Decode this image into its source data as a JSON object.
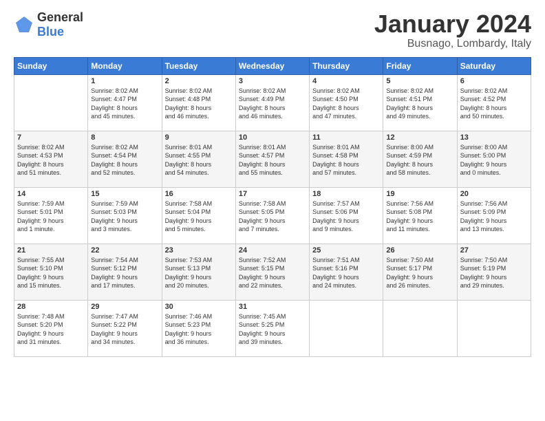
{
  "header": {
    "logo": {
      "general": "General",
      "blue": "Blue"
    },
    "title": "January 2024",
    "location": "Busnago, Lombardy, Italy"
  },
  "calendar": {
    "days_of_week": [
      "Sunday",
      "Monday",
      "Tuesday",
      "Wednesday",
      "Thursday",
      "Friday",
      "Saturday"
    ],
    "weeks": [
      [
        {
          "day": "",
          "info": ""
        },
        {
          "day": "1",
          "info": "Sunrise: 8:02 AM\nSunset: 4:47 PM\nDaylight: 8 hours\nand 45 minutes."
        },
        {
          "day": "2",
          "info": "Sunrise: 8:02 AM\nSunset: 4:48 PM\nDaylight: 8 hours\nand 46 minutes."
        },
        {
          "day": "3",
          "info": "Sunrise: 8:02 AM\nSunset: 4:49 PM\nDaylight: 8 hours\nand 46 minutes."
        },
        {
          "day": "4",
          "info": "Sunrise: 8:02 AM\nSunset: 4:50 PM\nDaylight: 8 hours\nand 47 minutes."
        },
        {
          "day": "5",
          "info": "Sunrise: 8:02 AM\nSunset: 4:51 PM\nDaylight: 8 hours\nand 49 minutes."
        },
        {
          "day": "6",
          "info": "Sunrise: 8:02 AM\nSunset: 4:52 PM\nDaylight: 8 hours\nand 50 minutes."
        }
      ],
      [
        {
          "day": "7",
          "info": "Sunrise: 8:02 AM\nSunset: 4:53 PM\nDaylight: 8 hours\nand 51 minutes."
        },
        {
          "day": "8",
          "info": "Sunrise: 8:02 AM\nSunset: 4:54 PM\nDaylight: 8 hours\nand 52 minutes."
        },
        {
          "day": "9",
          "info": "Sunrise: 8:01 AM\nSunset: 4:55 PM\nDaylight: 8 hours\nand 54 minutes."
        },
        {
          "day": "10",
          "info": "Sunrise: 8:01 AM\nSunset: 4:57 PM\nDaylight: 8 hours\nand 55 minutes."
        },
        {
          "day": "11",
          "info": "Sunrise: 8:01 AM\nSunset: 4:58 PM\nDaylight: 8 hours\nand 57 minutes."
        },
        {
          "day": "12",
          "info": "Sunrise: 8:00 AM\nSunset: 4:59 PM\nDaylight: 8 hours\nand 58 minutes."
        },
        {
          "day": "13",
          "info": "Sunrise: 8:00 AM\nSunset: 5:00 PM\nDaylight: 9 hours\nand 0 minutes."
        }
      ],
      [
        {
          "day": "14",
          "info": "Sunrise: 7:59 AM\nSunset: 5:01 PM\nDaylight: 9 hours\nand 1 minute."
        },
        {
          "day": "15",
          "info": "Sunrise: 7:59 AM\nSunset: 5:03 PM\nDaylight: 9 hours\nand 3 minutes."
        },
        {
          "day": "16",
          "info": "Sunrise: 7:58 AM\nSunset: 5:04 PM\nDaylight: 9 hours\nand 5 minutes."
        },
        {
          "day": "17",
          "info": "Sunrise: 7:58 AM\nSunset: 5:05 PM\nDaylight: 9 hours\nand 7 minutes."
        },
        {
          "day": "18",
          "info": "Sunrise: 7:57 AM\nSunset: 5:06 PM\nDaylight: 9 hours\nand 9 minutes."
        },
        {
          "day": "19",
          "info": "Sunrise: 7:56 AM\nSunset: 5:08 PM\nDaylight: 9 hours\nand 11 minutes."
        },
        {
          "day": "20",
          "info": "Sunrise: 7:56 AM\nSunset: 5:09 PM\nDaylight: 9 hours\nand 13 minutes."
        }
      ],
      [
        {
          "day": "21",
          "info": "Sunrise: 7:55 AM\nSunset: 5:10 PM\nDaylight: 9 hours\nand 15 minutes."
        },
        {
          "day": "22",
          "info": "Sunrise: 7:54 AM\nSunset: 5:12 PM\nDaylight: 9 hours\nand 17 minutes."
        },
        {
          "day": "23",
          "info": "Sunrise: 7:53 AM\nSunset: 5:13 PM\nDaylight: 9 hours\nand 20 minutes."
        },
        {
          "day": "24",
          "info": "Sunrise: 7:52 AM\nSunset: 5:15 PM\nDaylight: 9 hours\nand 22 minutes."
        },
        {
          "day": "25",
          "info": "Sunrise: 7:51 AM\nSunset: 5:16 PM\nDaylight: 9 hours\nand 24 minutes."
        },
        {
          "day": "26",
          "info": "Sunrise: 7:50 AM\nSunset: 5:17 PM\nDaylight: 9 hours\nand 26 minutes."
        },
        {
          "day": "27",
          "info": "Sunrise: 7:50 AM\nSunset: 5:19 PM\nDaylight: 9 hours\nand 29 minutes."
        }
      ],
      [
        {
          "day": "28",
          "info": "Sunrise: 7:48 AM\nSunset: 5:20 PM\nDaylight: 9 hours\nand 31 minutes."
        },
        {
          "day": "29",
          "info": "Sunrise: 7:47 AM\nSunset: 5:22 PM\nDaylight: 9 hours\nand 34 minutes."
        },
        {
          "day": "30",
          "info": "Sunrise: 7:46 AM\nSunset: 5:23 PM\nDaylight: 9 hours\nand 36 minutes."
        },
        {
          "day": "31",
          "info": "Sunrise: 7:45 AM\nSunset: 5:25 PM\nDaylight: 9 hours\nand 39 minutes."
        },
        {
          "day": "",
          "info": ""
        },
        {
          "day": "",
          "info": ""
        },
        {
          "day": "",
          "info": ""
        }
      ]
    ]
  }
}
